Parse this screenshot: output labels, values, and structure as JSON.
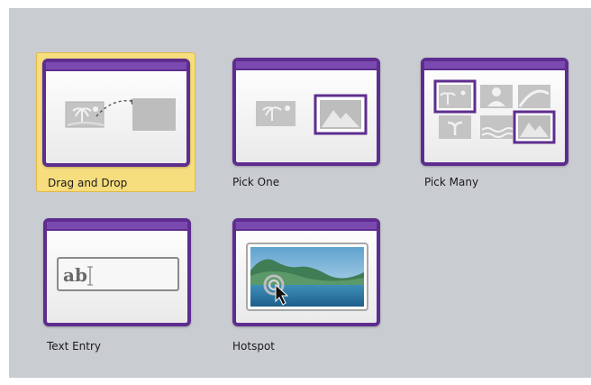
{
  "interactions": [
    {
      "id": "drag-and-drop",
      "label": "Drag and Drop",
      "selected": true
    },
    {
      "id": "pick-one",
      "label": "Pick One",
      "selected": false
    },
    {
      "id": "pick-many",
      "label": "Pick Many",
      "selected": false
    },
    {
      "id": "text-entry",
      "label": "Text Entry",
      "selected": false
    },
    {
      "id": "hotspot",
      "label": "Hotspot",
      "selected": false
    }
  ],
  "text_entry_sample": "ab",
  "colors": {
    "frame": "#5e2d8f",
    "title_bar": "#7a4ab0",
    "selection": "#f6dd7e",
    "background": "#c9ccd1"
  }
}
